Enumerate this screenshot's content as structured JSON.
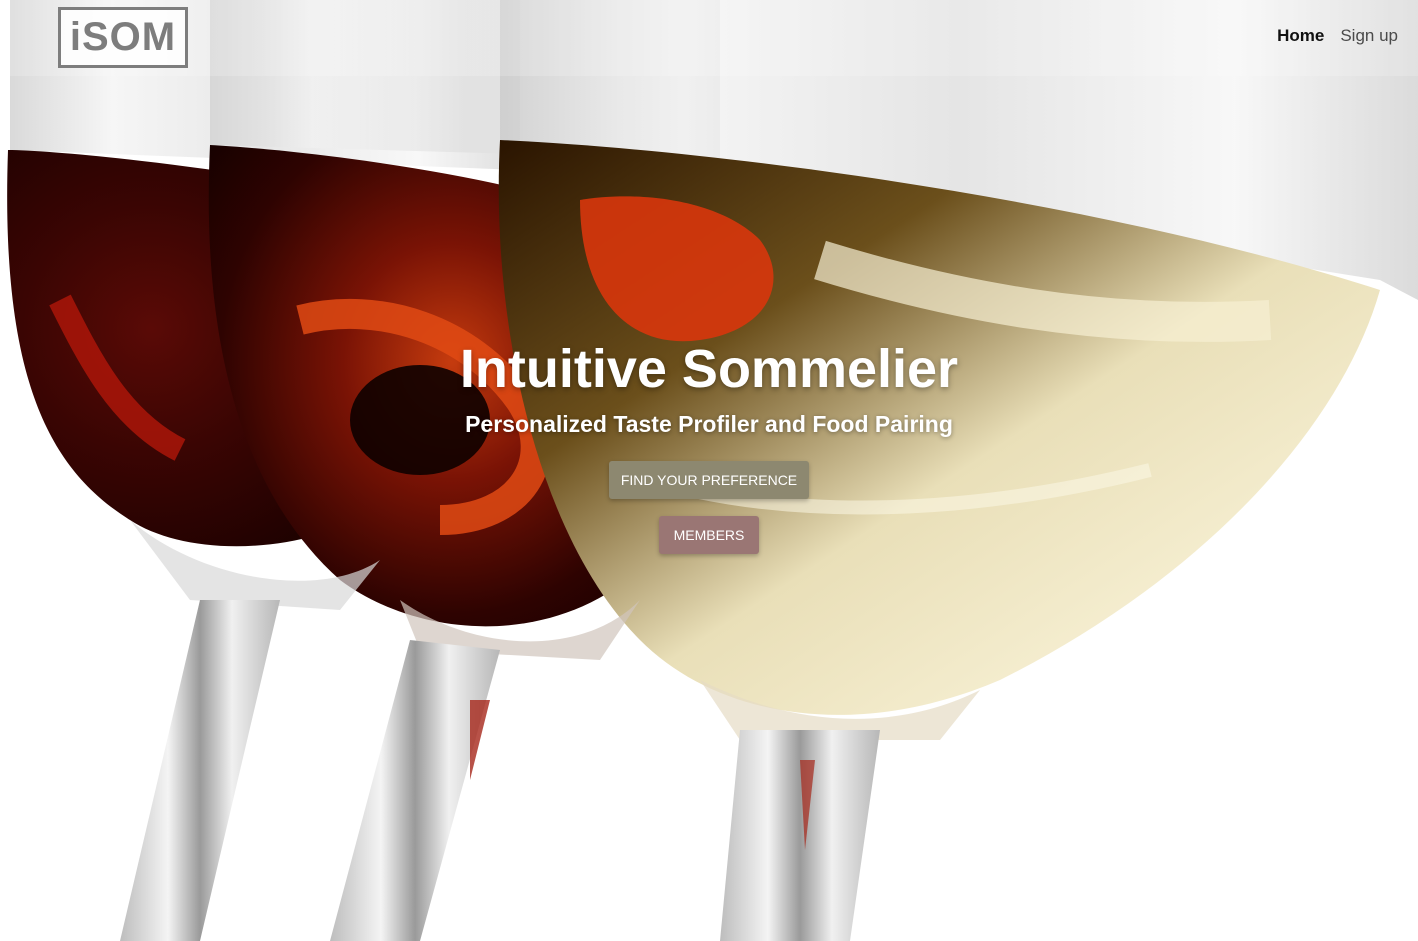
{
  "navbar": {
    "logo_text": "iSOM",
    "links": [
      {
        "label": "Home"
      },
      {
        "label": "Sign up"
      }
    ]
  },
  "hero": {
    "title": "Intuitive Sommelier",
    "subtitle": "Personalized Taste Profiler and Food Pairing",
    "buttons": {
      "find_preference": "FIND YOUR PREFERENCE",
      "members": "MEMBERS"
    },
    "background_image": "three-wine-glasses-photo",
    "colors": {
      "find_button": "#8d8870",
      "members_button": "#9a7674"
    }
  }
}
